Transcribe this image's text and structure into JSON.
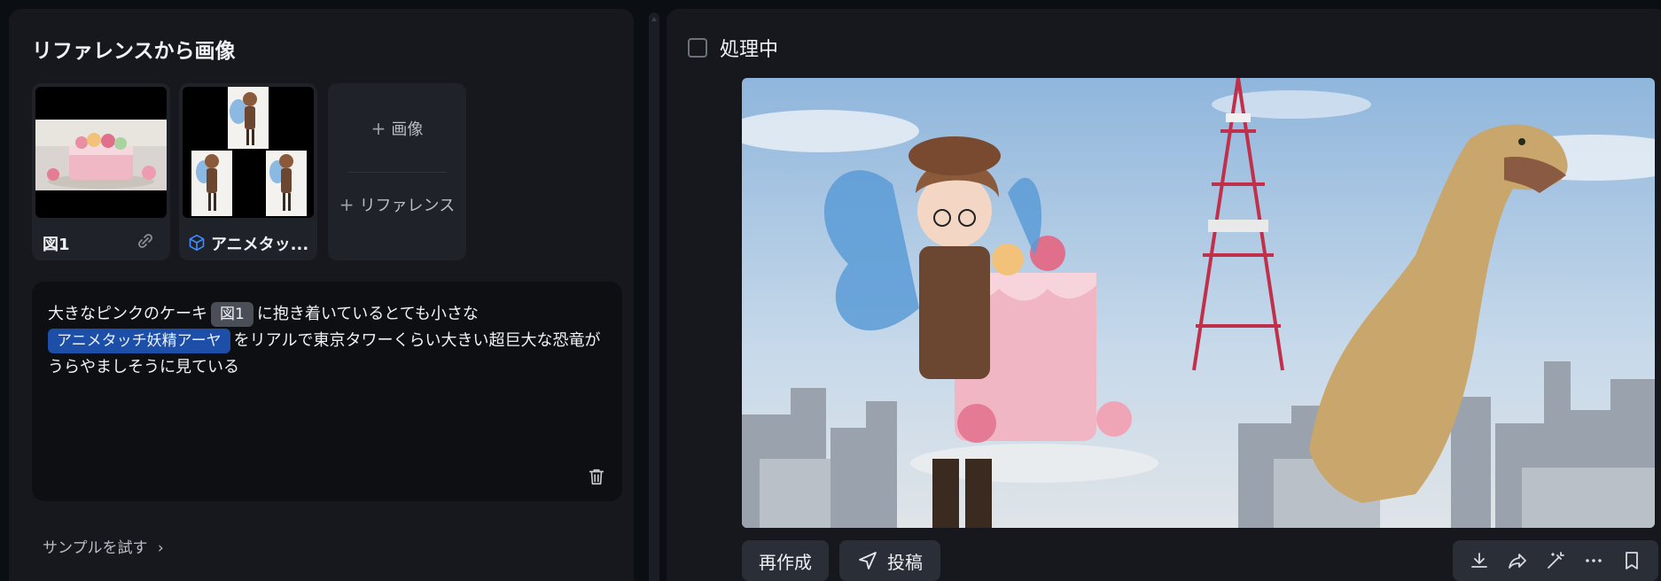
{
  "left": {
    "title": "リファレンスから画像",
    "tiles": [
      {
        "caption": "図1",
        "icon": "link-icon"
      },
      {
        "caption": "アニメタッ...",
        "icon": "cube-icon"
      }
    ],
    "add_image": "画像",
    "add_reference": "リファレンス",
    "prompt": {
      "part1": "大きなピンクのケーキ",
      "chip1": "図1",
      "part2": "に抱き着いているとても小さな",
      "chip2": "アニメタッチ妖精アーヤ",
      "part3": "をリアルで東京タワーくらい大きい超巨大な恐竜がうらやましそうに見ている"
    },
    "sample_link": "サンプルを試す"
  },
  "right": {
    "status": "処理中",
    "regen": "再作成",
    "post": "投稿",
    "toolbar_icons": [
      "download-icon",
      "share-icon",
      "magic-wand-icon",
      "more-icon",
      "bookmark-icon"
    ]
  },
  "colors": {
    "chip_blue": "#1d4fa8",
    "panel": "#16181d",
    "prompt_bg": "#0d0f13"
  }
}
